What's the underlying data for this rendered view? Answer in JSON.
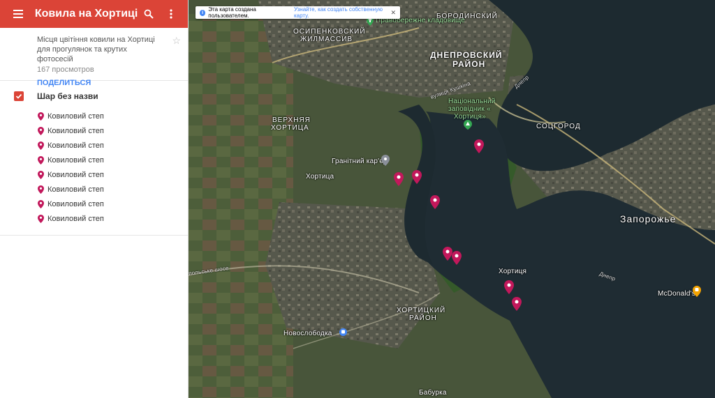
{
  "header": {
    "title": "Ковила на Хортиці"
  },
  "info": {
    "description": "Місця цвітіння ковили на Хортиці для прогулянок та крутих фотосесій",
    "views": "167 просмотров",
    "share_label": "ПОДЕЛИТЬСЯ"
  },
  "layer": {
    "name": "Шар без назви",
    "items": [
      {
        "label": "Ковиловий степ"
      },
      {
        "label": "Ковиловий степ"
      },
      {
        "label": "Ковиловий степ"
      },
      {
        "label": "Ковиловий степ"
      },
      {
        "label": "Ковиловий степ"
      },
      {
        "label": "Ковиловий степ"
      },
      {
        "label": "Ковиловий степ"
      },
      {
        "label": "Ковиловий степ"
      }
    ]
  },
  "banner": {
    "text": "Эта карта создана пользователем.",
    "link": "Узнайте, как создать собственную карту."
  },
  "map_labels": {
    "borodinsky": "БОРОДИНСКИЙ",
    "dneprovsky_1": "ДНЕПРОВСКИЙ",
    "dneprovsky_2": "РАЙОН",
    "osipenkovsky_1": "ОСИПЕНКОВСКИЙ",
    "osipenkovsky_2": "ЖИЛМАССИВ",
    "verkhnyaya_1": "ВЕРХНЯЯ",
    "verkhnyaya_2": "ХОРТИЦА",
    "khortitsa_town": "Хортица",
    "granitny": "Гранітний кар'єр",
    "reserve_1": "Національний",
    "reserve_2": "заповідник «",
    "reserve_3": "Хортиця»",
    "cemetery": "Правобережне кладовище",
    "sotsgorod": "СОЦГОРОД",
    "zaporozhye": "Запорожье",
    "khortitsa_island": "Хортиця",
    "mcdonalds": "McDonald's",
    "khortitsky_1": "ХОРТИЦКИЙ",
    "khortitsky_2": "РАЙОН",
    "novosloboda": "Новослободка",
    "baburka": "Бабурка",
    "dnepr_1": "Днепр",
    "dnepr_2": "Днепр",
    "shosse": "польське шосе",
    "kushkina": "вулиця Кушкіна"
  },
  "colors": {
    "header_red": "#db4437",
    "pin_pink": "#c2185b",
    "link_blue": "#4285f4"
  }
}
